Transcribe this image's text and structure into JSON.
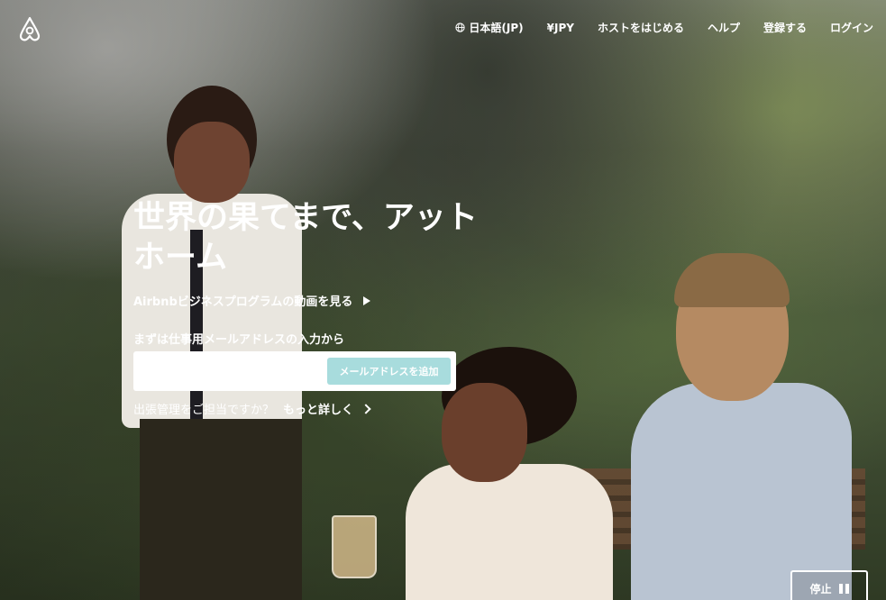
{
  "brand": {
    "logo_icon": "airbnb-logo-icon"
  },
  "nav": {
    "language": "日本語(JP)",
    "currency": "¥JPY",
    "host": "ホストをはじめる",
    "help": "ヘルプ",
    "signup": "登録する",
    "login": "ログイン"
  },
  "hero": {
    "title_line1": "世界の果てまで、アット",
    "title_line2": "ホーム",
    "video_link": "Airbnbビジネスプログラムの動画を見る",
    "email_label": "まずは仕事用メールアドレスの入力から",
    "email_placeholder": "",
    "email_value": "",
    "add_email_button": "メールアドレスを追加",
    "travel_manager_question": "出張管理をご担当ですか？",
    "learn_more": "もっと詳しく"
  },
  "video_controls": {
    "pause_label": "停止"
  },
  "colors": {
    "button_accent": "#a8dcdd",
    "text": "#ffffff"
  }
}
